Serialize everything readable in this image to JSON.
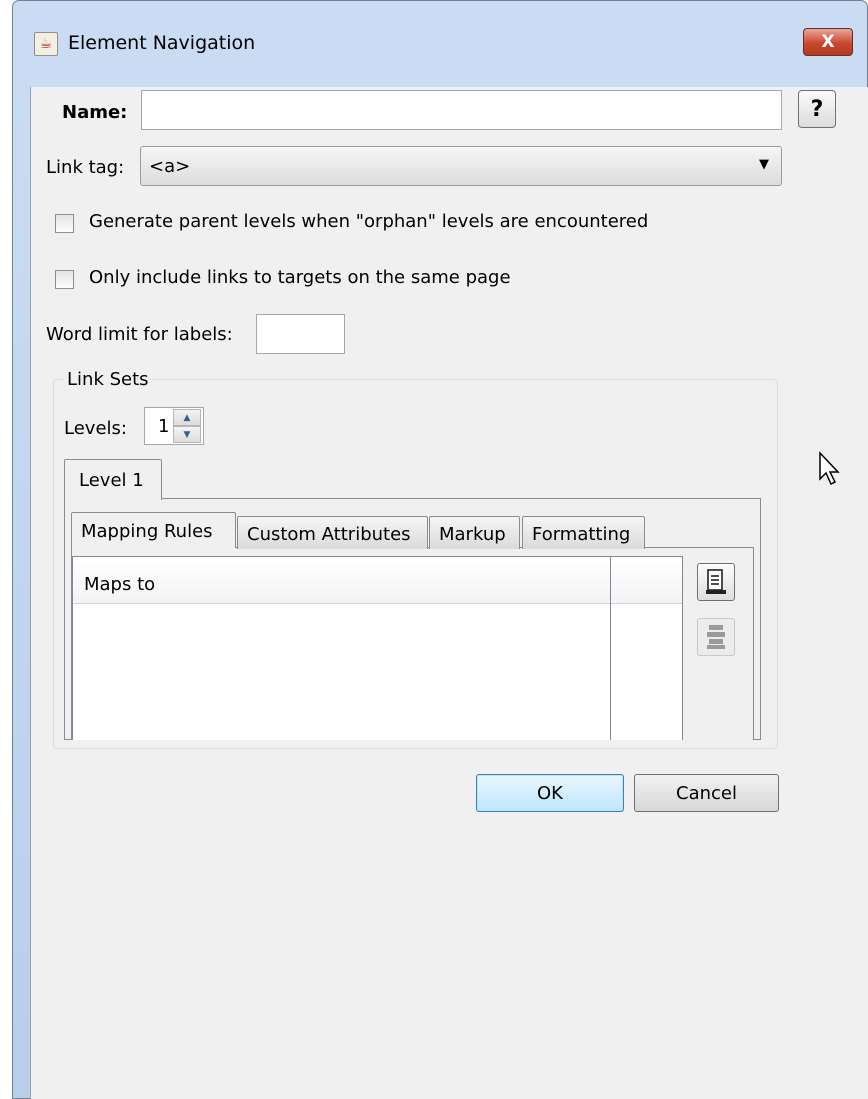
{
  "window": {
    "title": "Element Navigation",
    "close_label": "X"
  },
  "form": {
    "name_label": "Name:",
    "name_value": "",
    "help_label": "?",
    "link_tag_label": "Link tag:",
    "link_tag_value": "<a>",
    "orphan_label": "Generate parent levels when \"orphan\" levels are encountered",
    "orphan_checked": false,
    "same_page_label": "Only include links to targets on the same page",
    "same_page_checked": false,
    "word_limit_label": "Word limit for labels:",
    "word_limit_value": ""
  },
  "link_sets": {
    "group_title": "Link Sets",
    "levels_label": "Levels:",
    "levels_value": "1",
    "level_tabs": [
      {
        "label": "Level 1"
      }
    ],
    "inner_tabs": [
      {
        "label": "Mapping Rules"
      },
      {
        "label": "Custom Attributes"
      },
      {
        "label": "Markup"
      },
      {
        "label": "Formatting"
      }
    ],
    "table_column": "Maps to"
  },
  "buttons": {
    "ok": "OK",
    "cancel": "Cancel"
  },
  "icons": {
    "app": "java-cup-icon",
    "add_rule": "add-row-icon",
    "remove_rule": "remove-row-icon",
    "cursor": "mouse-pointer-icon"
  },
  "colors": {
    "title_bar": "#c9dcf3",
    "close_button": "#c9472e",
    "client_bg": "#f0f0f0"
  }
}
